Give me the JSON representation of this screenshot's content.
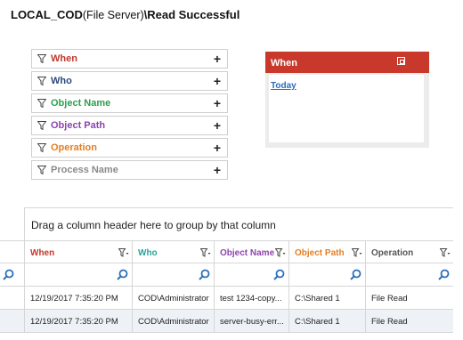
{
  "title": {
    "prefix": "LOCAL_COD",
    "middle": "(File Server)",
    "suffix": "\\Read Successful"
  },
  "filters": [
    {
      "label": "When",
      "color": "#c0392b"
    },
    {
      "label": "Who",
      "color": "#2e4a7a"
    },
    {
      "label": "Object Name",
      "color": "#2e9e4e"
    },
    {
      "label": "Object Path",
      "color": "#8e44ad"
    },
    {
      "label": "Operation",
      "color": "#e67e22"
    },
    {
      "label": "Process Name",
      "color": "#8a8a8a"
    }
  ],
  "when_panel": {
    "header": "When",
    "header_color": "#c8392b",
    "link": "Today"
  },
  "grid": {
    "group_hint": "Drag a column header here to group by that column",
    "columns": [
      {
        "label": "When",
        "color": "#c0392b"
      },
      {
        "label": "Who",
        "color": "#2aa39a"
      },
      {
        "label": "Object Name",
        "color": "#8e44ad"
      },
      {
        "label": "Object Path",
        "color": "#e67e22"
      },
      {
        "label": "Operation",
        "color": "#555555"
      }
    ],
    "rows": [
      [
        "12/19/2017 7:35:20 PM",
        "COD\\Administrator",
        "test 1234-copy...",
        "C:\\Shared 1",
        "File Read"
      ],
      [
        "12/19/2017 7:35:20 PM",
        "COD\\Administrator",
        "server-busy-err...",
        "C:\\Shared 1",
        "File Read"
      ]
    ]
  }
}
